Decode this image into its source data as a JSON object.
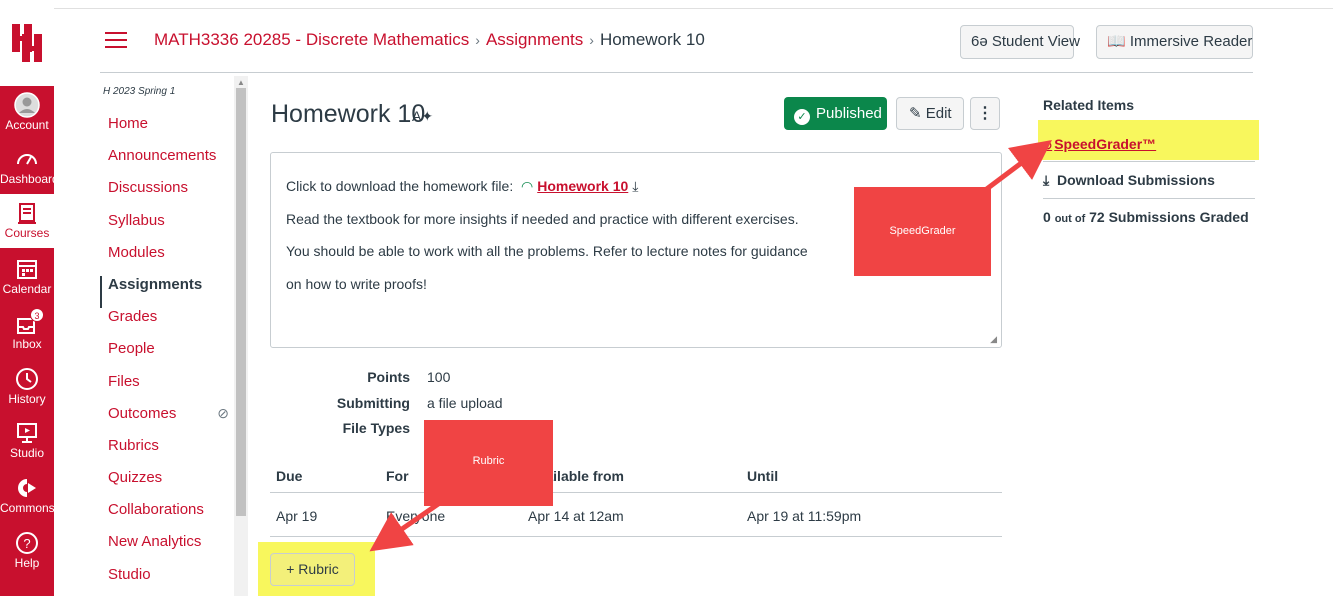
{
  "global_nav": {
    "items": [
      {
        "label": "Account",
        "icon": "account-icon"
      },
      {
        "label": "Dashboard",
        "icon": "dashboard-icon"
      },
      {
        "label": "Courses",
        "icon": "courses-icon"
      },
      {
        "label": "Calendar",
        "icon": "calendar-icon"
      },
      {
        "label": "Inbox",
        "icon": "inbox-icon",
        "badge": "3"
      },
      {
        "label": "History",
        "icon": "history-icon"
      },
      {
        "label": "Studio",
        "icon": "studio-icon"
      },
      {
        "label": "Commons",
        "icon": "commons-icon"
      },
      {
        "label": "Help",
        "icon": "help-icon"
      }
    ],
    "brand_color": "#c8102e"
  },
  "header": {
    "breadcrumb": {
      "course": "MATH3336 20285 - Discrete Mathematics",
      "section": "Assignments",
      "current": "Homework 10"
    },
    "student_view": "Student View",
    "immersive_reader": "Immersive Reader"
  },
  "course_nav": {
    "term": "H 2023 Spring 1",
    "items": [
      {
        "label": "Home"
      },
      {
        "label": "Announcements"
      },
      {
        "label": "Discussions"
      },
      {
        "label": "Syllabus"
      },
      {
        "label": "Modules"
      },
      {
        "label": "Assignments",
        "active": true
      },
      {
        "label": "Grades"
      },
      {
        "label": "People"
      },
      {
        "label": "Files"
      },
      {
        "label": "Outcomes"
      },
      {
        "label": "Rubrics"
      },
      {
        "label": "Quizzes"
      },
      {
        "label": "Collaborations"
      },
      {
        "label": "New Analytics"
      },
      {
        "label": "Studio"
      }
    ]
  },
  "assignment": {
    "title": "Homework 10",
    "published_label": "Published",
    "edit_label": "Edit",
    "description": {
      "line1_prefix": "Click to download the homework file:",
      "file_link": "Homework 10",
      "line2": "Read the textbook for more insights if needed and practice with different exercises.",
      "line3": "You should be able to work with all the problems. Refer to lecture notes for guidance",
      "line4": "on how to write proofs!"
    },
    "details": {
      "points_label": "Points",
      "points_value": "100",
      "submitting_label": "Submitting",
      "submitting_value": "a file upload",
      "file_types_label": "File Types"
    },
    "dates": {
      "headers": {
        "due": "Due",
        "for": "For",
        "available": "Available from",
        "until": "Until"
      },
      "row": {
        "due": "Apr 19",
        "for": "Everyone",
        "available": "Apr 14 at 12am",
        "until": "Apr 19 at 11:59pm"
      }
    },
    "rubric_button": "Rubric"
  },
  "related": {
    "title": "Related Items",
    "speedgrader": "SpeedGrader™",
    "download": "Download Submissions",
    "graded_count": "0",
    "graded_mid": "out of",
    "graded_total": "72 Submissions Graded"
  },
  "annotations": {
    "speedgrader_callout": "SpeedGrader",
    "rubric_callout": "Rubric",
    "highlight_color": "#f8f75d",
    "callout_color": "#f04444"
  }
}
